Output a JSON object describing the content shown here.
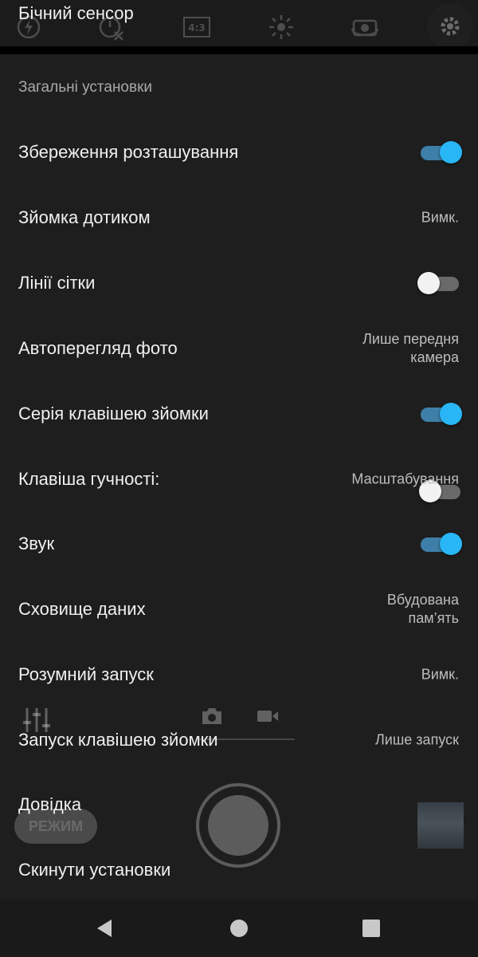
{
  "overlap_row": {
    "label": "Бічний сенсор",
    "toggle": "off"
  },
  "top_toolbar": {
    "icons": [
      "flash-auto-icon",
      "timer-off-icon",
      "aspect-ratio-icon",
      "brightness-icon",
      "switch-camera-icon",
      "settings-gear-icon"
    ],
    "aspect_label": "4:3"
  },
  "section_header": "Загальні установки",
  "settings": [
    {
      "label": "Збереження розташування",
      "type": "toggle",
      "state": "on"
    },
    {
      "label": "Зйомка дотиком",
      "type": "value",
      "value": "Вимк."
    },
    {
      "label": "Лінії сітки",
      "type": "toggle",
      "state": "off"
    },
    {
      "label": "Автоперегляд фото",
      "type": "value",
      "value_lines": [
        "Лише передня",
        "камера"
      ]
    },
    {
      "label": "Серія клавішею зйомки",
      "type": "toggle",
      "state": "on"
    },
    {
      "label": "Клавіша гучності:",
      "type": "value",
      "value": "Масштабування"
    },
    {
      "label": "Звук",
      "type": "toggle",
      "state": "on"
    },
    {
      "label": "Сховище даних",
      "type": "value",
      "value_lines": [
        "Вбудована",
        "пам’ять"
      ]
    },
    {
      "label": "Розумний запуск",
      "type": "value",
      "value": "Вимк."
    },
    {
      "label": "Запуск клавішею зйомки",
      "type": "value",
      "value": "Лише запуск"
    },
    {
      "label": "Довідка",
      "type": "link"
    },
    {
      "label": "Скинути установки",
      "type": "link"
    }
  ],
  "camera_overlay": {
    "mode_label": "РЕЖИМ"
  },
  "navbar": {
    "buttons": [
      "back-icon",
      "home-icon",
      "recents-icon"
    ]
  },
  "colors": {
    "background": "#1e1e1e",
    "accent": "#29b6f6",
    "accent_track": "#3d7fa8",
    "text_primary": "#f0f0f0",
    "text_secondary": "#bdbdbd",
    "header_text": "#a9a9a9"
  }
}
